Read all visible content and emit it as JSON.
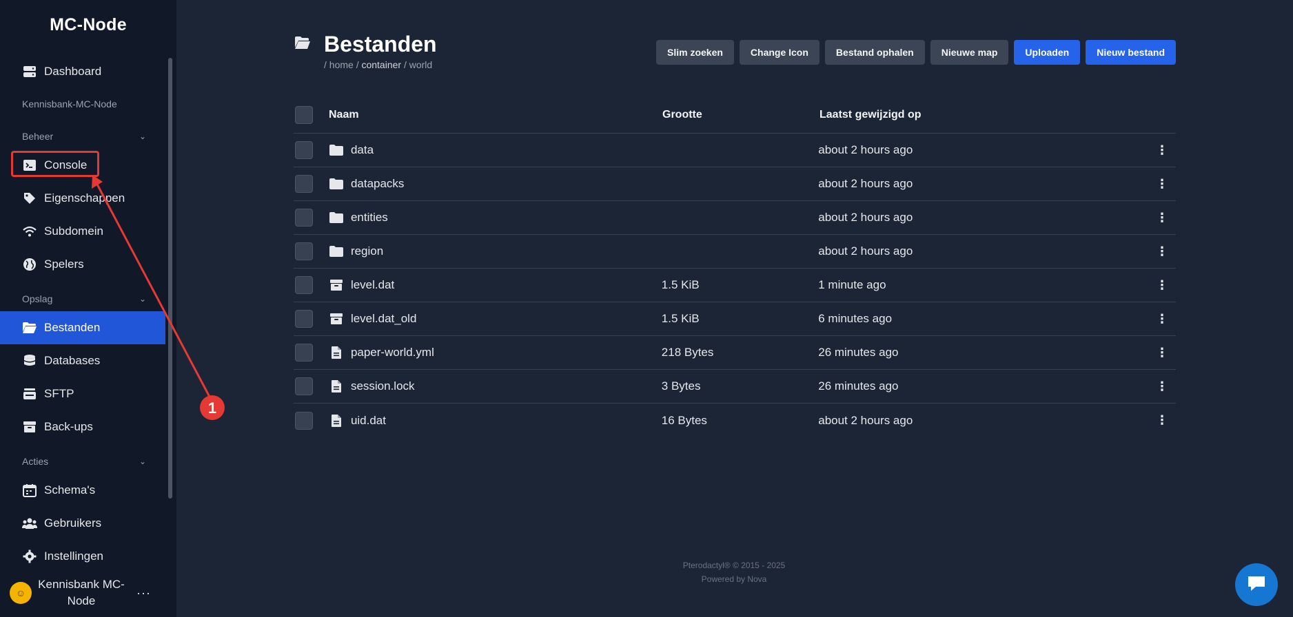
{
  "sidebar": {
    "brand": "MC-Node",
    "dashboard": "Dashboard",
    "server_label": "Kennisbank-MC-Node",
    "sections": {
      "beheer": "Beheer",
      "opslag": "Opslag",
      "acties": "Acties"
    },
    "items": {
      "console": "Console",
      "eigenschappen": "Eigenschappen",
      "subdomein": "Subdomein",
      "spelers": "Spelers",
      "bestanden": "Bestanden",
      "databases": "Databases",
      "sftp": "SFTP",
      "backups": "Back-ups",
      "schemas": "Schema's",
      "gebruikers": "Gebruikers",
      "instellingen": "Instellingen"
    },
    "user": {
      "name": "Kennisbank MC-Node",
      "more": "···"
    }
  },
  "header": {
    "title": "Bestanden",
    "breadcrumb": {
      "prefix": "/ home / ",
      "current": "container",
      "suffix": " / world"
    }
  },
  "toolbar": {
    "smart_search": "Slim zoeken",
    "change_icon": "Change Icon",
    "fetch_file": "Bestand ophalen",
    "new_folder": "Nieuwe map",
    "upload": "Uploaden",
    "new_file": "Nieuw bestand"
  },
  "table": {
    "columns": {
      "name": "Naam",
      "size": "Grootte",
      "modified": "Laatst gewijzigd op"
    },
    "rows": [
      {
        "icon": "folder-icon",
        "name": "data",
        "size": "",
        "modified": "about 2 hours ago"
      },
      {
        "icon": "folder-icon",
        "name": "datapacks",
        "size": "",
        "modified": "about 2 hours ago"
      },
      {
        "icon": "folder-icon",
        "name": "entities",
        "size": "",
        "modified": "about 2 hours ago"
      },
      {
        "icon": "folder-icon",
        "name": "region",
        "size": "",
        "modified": "about 2 hours ago"
      },
      {
        "icon": "archive-icon",
        "name": "level.dat",
        "size": "1.5 KiB",
        "modified": "1 minute ago"
      },
      {
        "icon": "archive-icon",
        "name": "level.dat_old",
        "size": "1.5 KiB",
        "modified": "6 minutes ago"
      },
      {
        "icon": "file-icon",
        "name": "paper-world.yml",
        "size": "218 Bytes",
        "modified": "26 minutes ago"
      },
      {
        "icon": "file-icon",
        "name": "session.lock",
        "size": "3 Bytes",
        "modified": "26 minutes ago"
      },
      {
        "icon": "file-icon",
        "name": "uid.dat",
        "size": "16 Bytes",
        "modified": "about 2 hours ago"
      }
    ]
  },
  "footer": {
    "line1": "Pterodactyl® © 2015 - 2025",
    "line2": "Powered by Nova"
  },
  "annotation": {
    "marker": "1"
  },
  "colors": {
    "accent": "#2563eb",
    "annotation": "#e53935",
    "sidebar_bg": "#111827",
    "main_bg": "#1c2536"
  }
}
